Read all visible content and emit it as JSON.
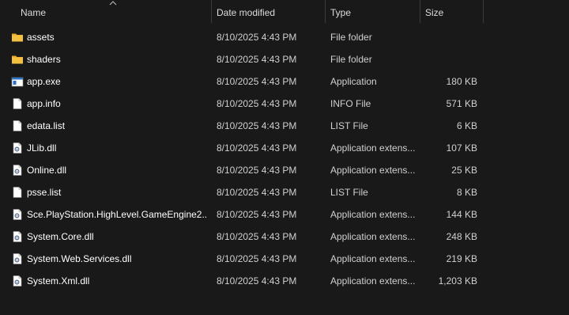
{
  "columns": {
    "name": "Name",
    "date": "Date modified",
    "type": "Type",
    "size": "Size"
  },
  "files": [
    {
      "name": "assets",
      "date": "8/10/2025 4:43 PM",
      "type": "File folder",
      "size": "",
      "icon": "folder-icon"
    },
    {
      "name": "shaders",
      "date": "8/10/2025 4:43 PM",
      "type": "File folder",
      "size": "",
      "icon": "folder-icon"
    },
    {
      "name": "app.exe",
      "date": "8/10/2025 4:43 PM",
      "type": "Application",
      "size": "180 KB",
      "icon": "application-icon"
    },
    {
      "name": "app.info",
      "date": "8/10/2025 4:43 PM",
      "type": "INFO File",
      "size": "571 KB",
      "icon": "file-icon"
    },
    {
      "name": "edata.list",
      "date": "8/10/2025 4:43 PM",
      "type": "LIST File",
      "size": "6 KB",
      "icon": "file-icon"
    },
    {
      "name": "JLib.dll",
      "date": "8/10/2025 4:43 PM",
      "type": "Application extens...",
      "size": "107 KB",
      "icon": "dll-icon"
    },
    {
      "name": "Online.dll",
      "date": "8/10/2025 4:43 PM",
      "type": "Application extens...",
      "size": "25 KB",
      "icon": "dll-icon"
    },
    {
      "name": "psse.list",
      "date": "8/10/2025 4:43 PM",
      "type": "LIST File",
      "size": "8 KB",
      "icon": "file-icon"
    },
    {
      "name": "Sce.PlayStation.HighLevel.GameEngine2...",
      "date": "8/10/2025 4:43 PM",
      "type": "Application extens...",
      "size": "144 KB",
      "icon": "dll-icon"
    },
    {
      "name": "System.Core.dll",
      "date": "8/10/2025 4:43 PM",
      "type": "Application extens...",
      "size": "248 KB",
      "icon": "dll-icon"
    },
    {
      "name": "System.Web.Services.dll",
      "date": "8/10/2025 4:43 PM",
      "type": "Application extens...",
      "size": "219 KB",
      "icon": "dll-icon"
    },
    {
      "name": "System.Xml.dll",
      "date": "8/10/2025 4:43 PM",
      "type": "Application extens...",
      "size": "1,203 KB",
      "icon": "dll-icon"
    }
  ],
  "colors": {
    "background": "#191919",
    "folder": "#f3c041",
    "header_separator": "#3c3c3c"
  }
}
